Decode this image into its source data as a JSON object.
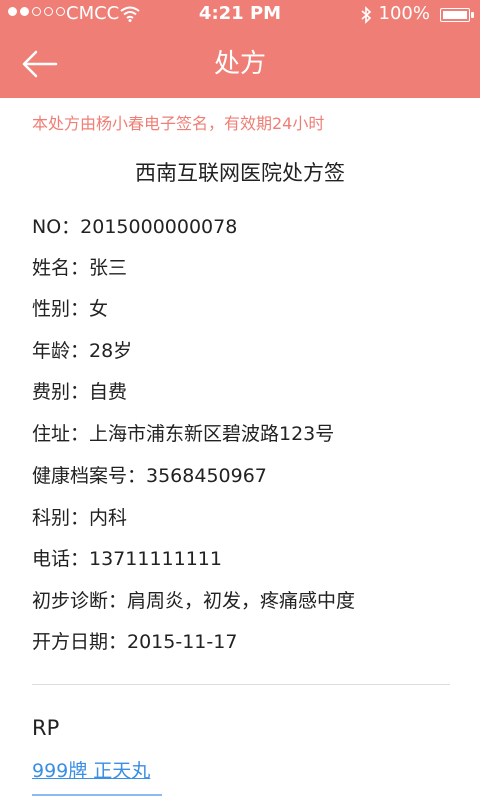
{
  "status_bar": {
    "carrier": "CMCC",
    "time": "4:21 PM",
    "battery": "100%"
  },
  "nav": {
    "title": "处方"
  },
  "notice": "本处方由杨小春电子签名，有效期24小时",
  "document": {
    "title": "西南互联网医院处方签",
    "fields": [
      "NO：2015000000078",
      "姓名：张三",
      "性别：女",
      "年龄：28岁",
      "费别：自费",
      "住址：上海市浦东新区碧波路123号",
      "健康档案号：3568450967",
      "科别：内科",
      "电话：13711111111",
      "初步诊断：肩周炎，初发，疼痛感中度",
      "开方日期：2015-11-17"
    ]
  },
  "rp": {
    "label": "RP",
    "drug": "999牌 正天丸"
  },
  "colors": {
    "header": "#ef7f76",
    "link": "#3a8ee6"
  }
}
